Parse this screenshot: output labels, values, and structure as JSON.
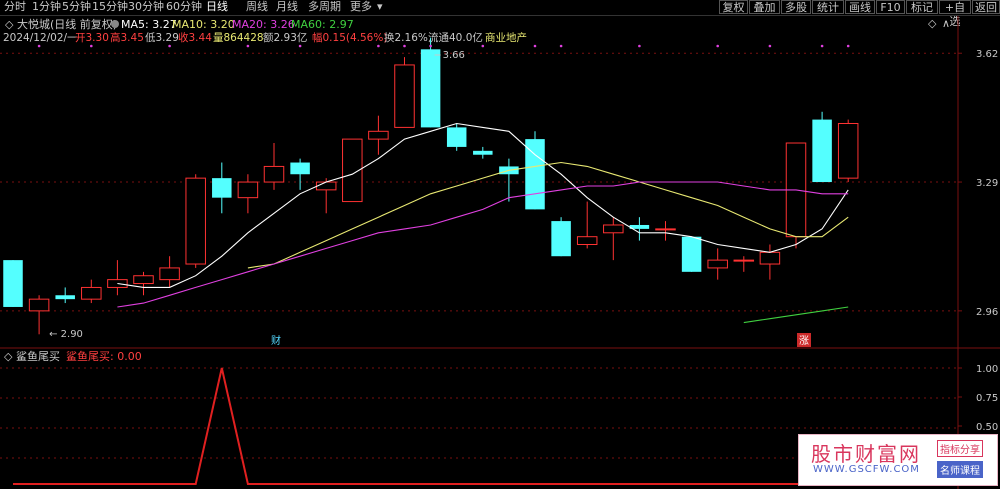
{
  "toolbar": {
    "periods": [
      "分时",
      "1分钟",
      "5分钟",
      "15分钟",
      "30分钟",
      "60分钟",
      "日线",
      "周线",
      "月线",
      "多周期",
      "更多"
    ],
    "active_period": "日线",
    "right_buttons": [
      "复权",
      "叠加",
      "多股",
      "统计",
      "画线",
      "F10",
      "标记",
      "+自选",
      "返回"
    ]
  },
  "header": {
    "stock_name": "大悦城(日线 前复权)",
    "ma_legend": [
      {
        "label": "MA5: 3.27",
        "color": "#ffffff"
      },
      {
        "label": "MA10: 3.20",
        "color": "#e8e872"
      },
      {
        "label": "MA20: 3.26",
        "color": "#e040e0"
      },
      {
        "label": "MA60: 2.97",
        "color": "#40d040"
      }
    ],
    "quote_items": [
      {
        "text": "2024/12/02/一",
        "color": "#c8c8c8"
      },
      {
        "text": "开3.30",
        "color": "#ff4040"
      },
      {
        "text": "高3.45",
        "color": "#ff4040"
      },
      {
        "text": "低3.29",
        "color": "#c8c8c8"
      },
      {
        "text": "收3.44",
        "color": "#ff4040"
      },
      {
        "text": "量864428",
        "color": "#e8e872"
      },
      {
        "text": "额2.93亿",
        "color": "#c8c8c8"
      },
      {
        "text": "幅0.15(4.56%)",
        "color": "#ff4040"
      },
      {
        "text": "换2.16%",
        "color": "#c8c8c8"
      },
      {
        "text": "流通40.0亿",
        "color": "#c8c8c8"
      },
      {
        "text": "商业地产",
        "color": "#e8e872"
      }
    ]
  },
  "indicator": {
    "name": "鲨鱼尾买",
    "value_label": "鲨鱼尾买: 0.00",
    "y_ticks": [
      "1.00",
      "0.75",
      "0.50",
      "0.25"
    ]
  },
  "colors": {
    "up": "#ff3232",
    "down": "#54ffff",
    "ma5": "#ffffff",
    "ma10": "#e8e872",
    "ma20": "#e040e0",
    "ma60": "#40d040",
    "grid": "#7a1010"
  },
  "chart_data": {
    "type": "candlestick",
    "price_axis": {
      "ticks": [
        3.62,
        3.29,
        2.96
      ],
      "ylim": [
        2.87,
        3.7
      ]
    },
    "annotations": {
      "high_label": "3.66",
      "low_label": "2.90",
      "event_markers": [
        "财",
        "涨"
      ]
    },
    "candles": [
      {
        "o": 3.09,
        "h": 3.09,
        "l": 2.97,
        "c": 2.97
      },
      {
        "o": 2.96,
        "h": 3.0,
        "l": 2.9,
        "c": 2.99
      },
      {
        "o": 3.0,
        "h": 3.02,
        "l": 2.98,
        "c": 2.99
      },
      {
        "o": 2.99,
        "h": 3.04,
        "l": 2.98,
        "c": 3.02
      },
      {
        "o": 3.02,
        "h": 3.09,
        "l": 3.0,
        "c": 3.04
      },
      {
        "o": 3.03,
        "h": 3.06,
        "l": 3.0,
        "c": 3.05
      },
      {
        "o": 3.04,
        "h": 3.1,
        "l": 3.02,
        "c": 3.07
      },
      {
        "o": 3.08,
        "h": 3.31,
        "l": 3.07,
        "c": 3.3
      },
      {
        "o": 3.3,
        "h": 3.34,
        "l": 3.21,
        "c": 3.25
      },
      {
        "o": 3.25,
        "h": 3.31,
        "l": 3.21,
        "c": 3.29
      },
      {
        "o": 3.29,
        "h": 3.39,
        "l": 3.27,
        "c": 3.33
      },
      {
        "o": 3.34,
        "h": 3.35,
        "l": 3.27,
        "c": 3.31
      },
      {
        "o": 3.27,
        "h": 3.3,
        "l": 3.21,
        "c": 3.29
      },
      {
        "o": 3.24,
        "h": 3.4,
        "l": 3.24,
        "c": 3.4
      },
      {
        "o": 3.4,
        "h": 3.46,
        "l": 3.36,
        "c": 3.42
      },
      {
        "o": 3.43,
        "h": 3.61,
        "l": 3.43,
        "c": 3.59
      },
      {
        "o": 3.63,
        "h": 3.66,
        "l": 3.43,
        "c": 3.43
      },
      {
        "o": 3.43,
        "h": 3.44,
        "l": 3.37,
        "c": 3.38
      },
      {
        "o": 3.37,
        "h": 3.38,
        "l": 3.35,
        "c": 3.36
      },
      {
        "o": 3.33,
        "h": 3.35,
        "l": 3.24,
        "c": 3.31
      },
      {
        "o": 3.4,
        "h": 3.42,
        "l": 3.22,
        "c": 3.22
      },
      {
        "o": 3.19,
        "h": 3.2,
        "l": 3.1,
        "c": 3.1
      },
      {
        "o": 3.13,
        "h": 3.24,
        "l": 3.12,
        "c": 3.15
      },
      {
        "o": 3.16,
        "h": 3.2,
        "l": 3.09,
        "c": 3.18
      },
      {
        "o": 3.18,
        "h": 3.2,
        "l": 3.14,
        "c": 3.17
      },
      {
        "o": 3.17,
        "h": 3.19,
        "l": 3.14,
        "c": 3.17
      },
      {
        "o": 3.15,
        "h": 3.15,
        "l": 3.06,
        "c": 3.06
      },
      {
        "o": 3.07,
        "h": 3.12,
        "l": 3.04,
        "c": 3.09
      },
      {
        "o": 3.09,
        "h": 3.1,
        "l": 3.06,
        "c": 3.09
      },
      {
        "o": 3.08,
        "h": 3.13,
        "l": 3.04,
        "c": 3.11
      },
      {
        "o": 3.15,
        "h": 3.39,
        "l": 3.12,
        "c": 3.39
      },
      {
        "o": 3.45,
        "h": 3.47,
        "l": 3.29,
        "c": 3.29
      },
      {
        "o": 3.3,
        "h": 3.45,
        "l": 3.29,
        "c": 3.44
      }
    ],
    "series": [
      {
        "name": "MA5",
        "values": [
          null,
          null,
          null,
          null,
          3.03,
          3.02,
          3.02,
          3.05,
          3.1,
          3.16,
          3.21,
          3.26,
          3.29,
          3.31,
          3.35,
          3.4,
          3.42,
          3.44,
          3.43,
          3.42,
          3.36,
          3.31,
          3.25,
          3.2,
          3.16,
          3.16,
          3.15,
          3.13,
          3.12,
          3.11,
          3.13,
          3.17,
          3.27
        ]
      },
      {
        "name": "MA10",
        "values": [
          null,
          null,
          null,
          null,
          null,
          null,
          null,
          null,
          null,
          3.07,
          3.08,
          3.11,
          3.14,
          3.17,
          3.2,
          3.23,
          3.26,
          3.28,
          3.3,
          3.32,
          3.33,
          3.34,
          3.33,
          3.31,
          3.29,
          3.27,
          3.25,
          3.23,
          3.2,
          3.17,
          3.15,
          3.15,
          3.2
        ]
      },
      {
        "name": "MA20",
        "values": [
          null,
          null,
          null,
          null,
          2.97,
          2.98,
          3.0,
          3.02,
          3.04,
          3.06,
          3.08,
          3.1,
          3.12,
          3.14,
          3.16,
          3.17,
          3.18,
          3.2,
          3.22,
          3.25,
          3.26,
          3.27,
          3.28,
          3.28,
          3.29,
          3.29,
          3.29,
          3.29,
          3.28,
          3.27,
          3.27,
          3.26,
          3.26
        ]
      },
      {
        "name": "MA60",
        "values": [
          null,
          null,
          null,
          null,
          null,
          null,
          null,
          null,
          null,
          null,
          null,
          null,
          null,
          null,
          null,
          null,
          null,
          null,
          null,
          null,
          null,
          null,
          null,
          null,
          null,
          null,
          null,
          null,
          2.93,
          2.94,
          2.95,
          2.96,
          2.97
        ]
      }
    ],
    "indicator_values": [
      0,
      0,
      0,
      0,
      0,
      0,
      0,
      0,
      1,
      0,
      0,
      0,
      0,
      0,
      0,
      0,
      0,
      0,
      0,
      0,
      0,
      0,
      0,
      0,
      0,
      0,
      0,
      0,
      0,
      0,
      0,
      0,
      0
    ],
    "top_markers": [
      1,
      3,
      6,
      9,
      11,
      14,
      15,
      16,
      18,
      20,
      21,
      24,
      27,
      29,
      31,
      32
    ]
  }
}
